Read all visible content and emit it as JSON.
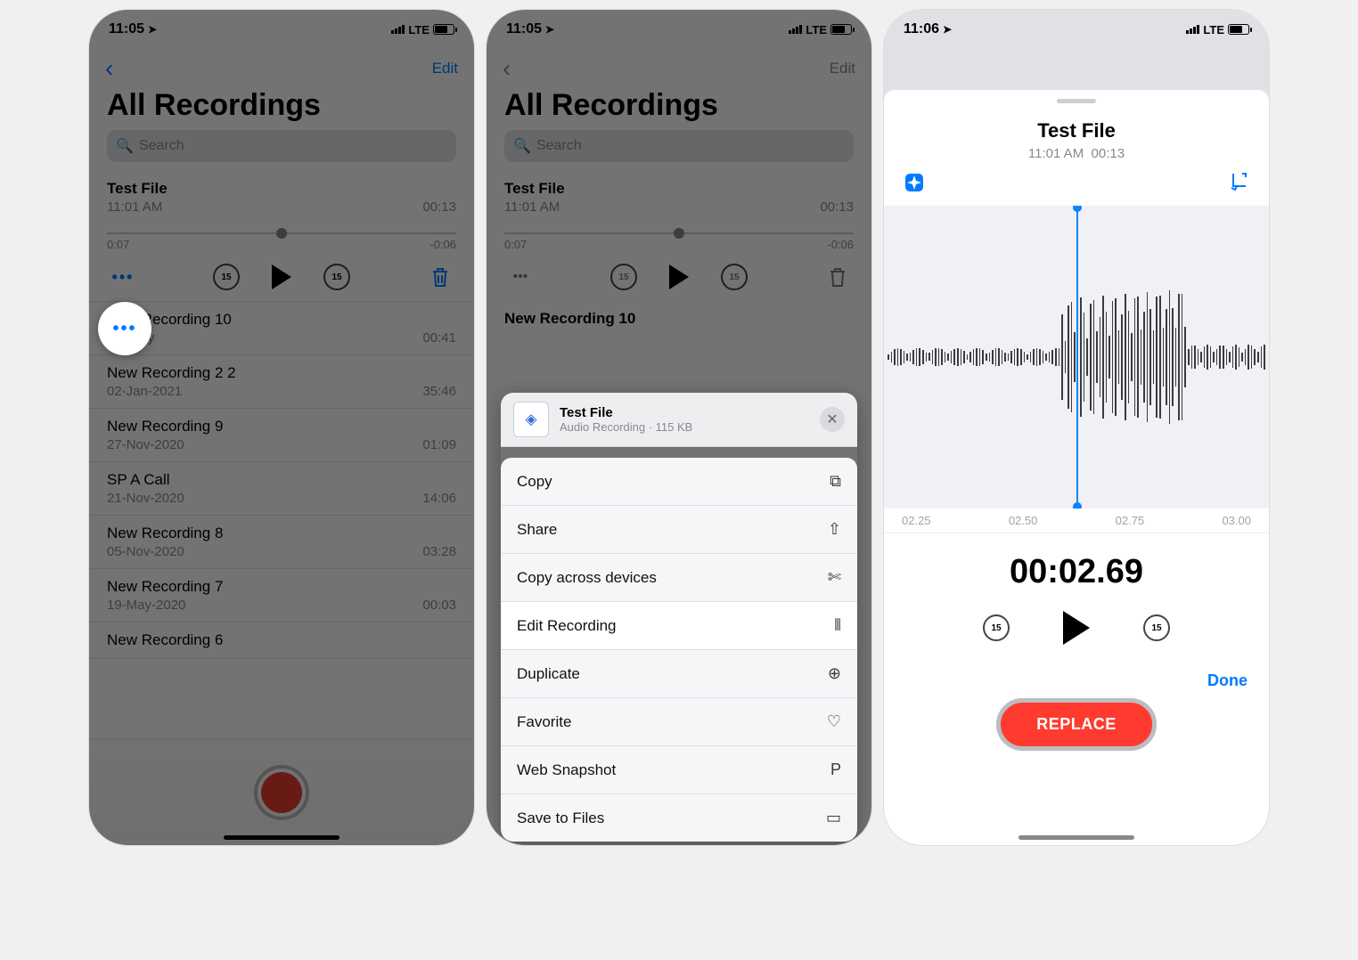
{
  "colors": {
    "accent": "#007aff",
    "danger": "#ff3b30"
  },
  "status": {
    "time1": "11:05",
    "time2": "11:05",
    "time3": "11:06",
    "carrier": "LTE"
  },
  "screen1": {
    "nav": {
      "edit": "Edit"
    },
    "title": "All Recordings",
    "search": {
      "placeholder": "Search"
    },
    "selected": {
      "title": "Test File",
      "subLeft": "11:01 AM",
      "subRight": "00:13",
      "scrubLeft": "0:07",
      "scrubRight": "-0:06"
    },
    "list": [
      {
        "title": "New Recording 10",
        "left": "Monday",
        "right": "00:41"
      },
      {
        "title": "New Recording 2 2",
        "left": "02-Jan-2021",
        "right": "35:46"
      },
      {
        "title": "New Recording 9",
        "left": "27-Nov-2020",
        "right": "01:09"
      },
      {
        "title": "SP A Call",
        "left": "21-Nov-2020",
        "right": "14:06"
      },
      {
        "title": "New Recording 8",
        "left": "05-Nov-2020",
        "right": "03:28"
      },
      {
        "title": "New Recording 7",
        "left": "19-May-2020",
        "right": "00:03"
      },
      {
        "title": "New Recording 6",
        "left": "",
        "right": ""
      }
    ]
  },
  "screen2": {
    "nav": {
      "edit": "Edit"
    },
    "title": "All Recordings",
    "search": {
      "placeholder": "Search"
    },
    "selected": {
      "title": "Test File",
      "subLeft": "11:01 AM",
      "subRight": "00:13",
      "scrubLeft": "0:07",
      "scrubRight": "-0:06"
    },
    "nextTitle": "New Recording 10",
    "sheet": {
      "title": "Test File",
      "subtitle": "Audio Recording · 115 KB",
      "rows": [
        {
          "label": "Copy",
          "icon": "⧉"
        },
        {
          "label": "Share",
          "icon": "⇧"
        },
        {
          "label": "Copy across devices",
          "icon": "✄"
        },
        {
          "label": "Edit Recording",
          "icon": "⦀"
        },
        {
          "label": "Duplicate",
          "icon": "⊕"
        },
        {
          "label": "Favorite",
          "icon": "♡"
        },
        {
          "label": "Web Snapshot",
          "icon": "P"
        },
        {
          "label": "Save to Files",
          "icon": "▭"
        }
      ]
    }
  },
  "screen3": {
    "title": "Test File",
    "subLeft": "11:01 AM",
    "subRight": "00:13",
    "ruler": [
      "02.25",
      "02.50",
      "02.75",
      "03.00"
    ],
    "time": "00:02.69",
    "replace": "REPLACE",
    "done": "Done"
  }
}
